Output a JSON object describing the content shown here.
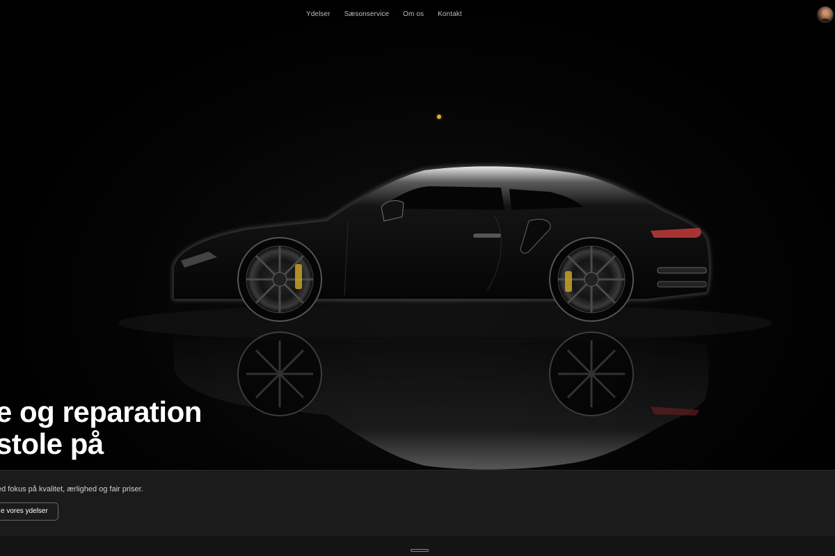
{
  "nav": {
    "items": [
      {
        "label": "Ydelser"
      },
      {
        "label": "Sæsonservice"
      },
      {
        "label": "Om os"
      },
      {
        "label": "Kontakt"
      }
    ]
  },
  "hero": {
    "headline_line1": "e og reparation",
    "headline_line2": " stole på"
  },
  "panel": {
    "subtitle": "ed fokus på kvalitet, ærlighed og fair priser.",
    "cta_label": "e vores ydelser"
  },
  "colors": {
    "accent": "#e6b422",
    "background": "#000000",
    "panel": "#1b1b1b",
    "text": "#ffffff"
  },
  "icons": {
    "avatar": "user-avatar",
    "dot": "status-dot"
  }
}
